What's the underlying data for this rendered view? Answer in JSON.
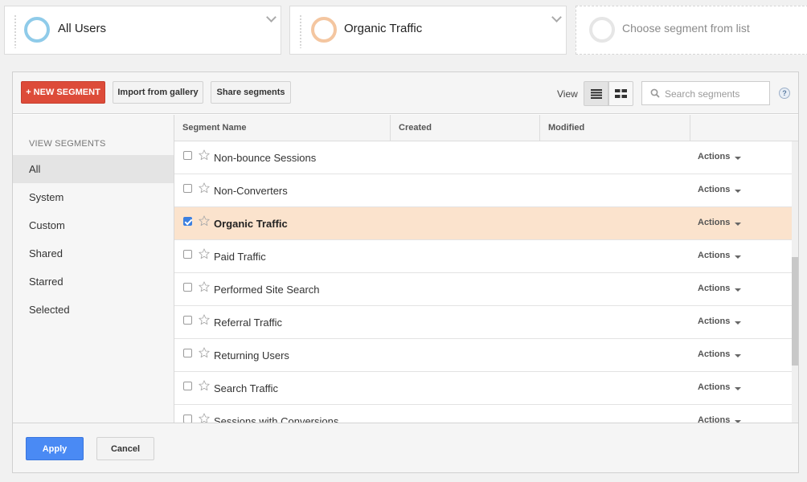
{
  "segment_cards": [
    {
      "name": "All Users",
      "ring_color": "#8fcbe9"
    },
    {
      "name": "Organic Traffic",
      "ring_color": "#f4c6a0"
    },
    {
      "name": "Choose segment from list",
      "ring_color": "#e6e6e6"
    }
  ],
  "toolbar": {
    "new_segment_label": "+ NEW SEGMENT",
    "import_label": "Import from gallery",
    "share_label": "Share segments",
    "view_label": "View",
    "search_placeholder": "Search segments",
    "help_label": "?"
  },
  "sidebar": {
    "heading": "VIEW SEGMENTS",
    "items": [
      {
        "label": "All",
        "active": true
      },
      {
        "label": "System"
      },
      {
        "label": "Custom"
      },
      {
        "label": "Shared"
      },
      {
        "label": "Starred"
      },
      {
        "label": "Selected"
      }
    ]
  },
  "table": {
    "columns": [
      "Segment Name",
      "Created",
      "Modified"
    ],
    "rows": [
      {
        "name": "Non-bounce Sessions",
        "checked": false,
        "action": "Actions"
      },
      {
        "name": "Non-Converters",
        "checked": false,
        "action": "Actions"
      },
      {
        "name": "Organic Traffic",
        "checked": true,
        "action": "Actions"
      },
      {
        "name": "Paid Traffic",
        "checked": false,
        "action": "Actions"
      },
      {
        "name": "Performed Site Search",
        "checked": false,
        "action": "Actions"
      },
      {
        "name": "Referral Traffic",
        "checked": false,
        "action": "Actions"
      },
      {
        "name": "Returning Users",
        "checked": false,
        "action": "Actions"
      },
      {
        "name": "Search Traffic",
        "checked": false,
        "action": "Actions"
      },
      {
        "name": "Sessions with Conversions",
        "checked": false,
        "action": "Actions"
      }
    ]
  },
  "footer": {
    "apply_label": "Apply",
    "cancel_label": "Cancel"
  },
  "colors": {
    "new_segment": "#dd4b39",
    "apply": "#4a8af4",
    "selected_row": "#fbe3cd"
  }
}
